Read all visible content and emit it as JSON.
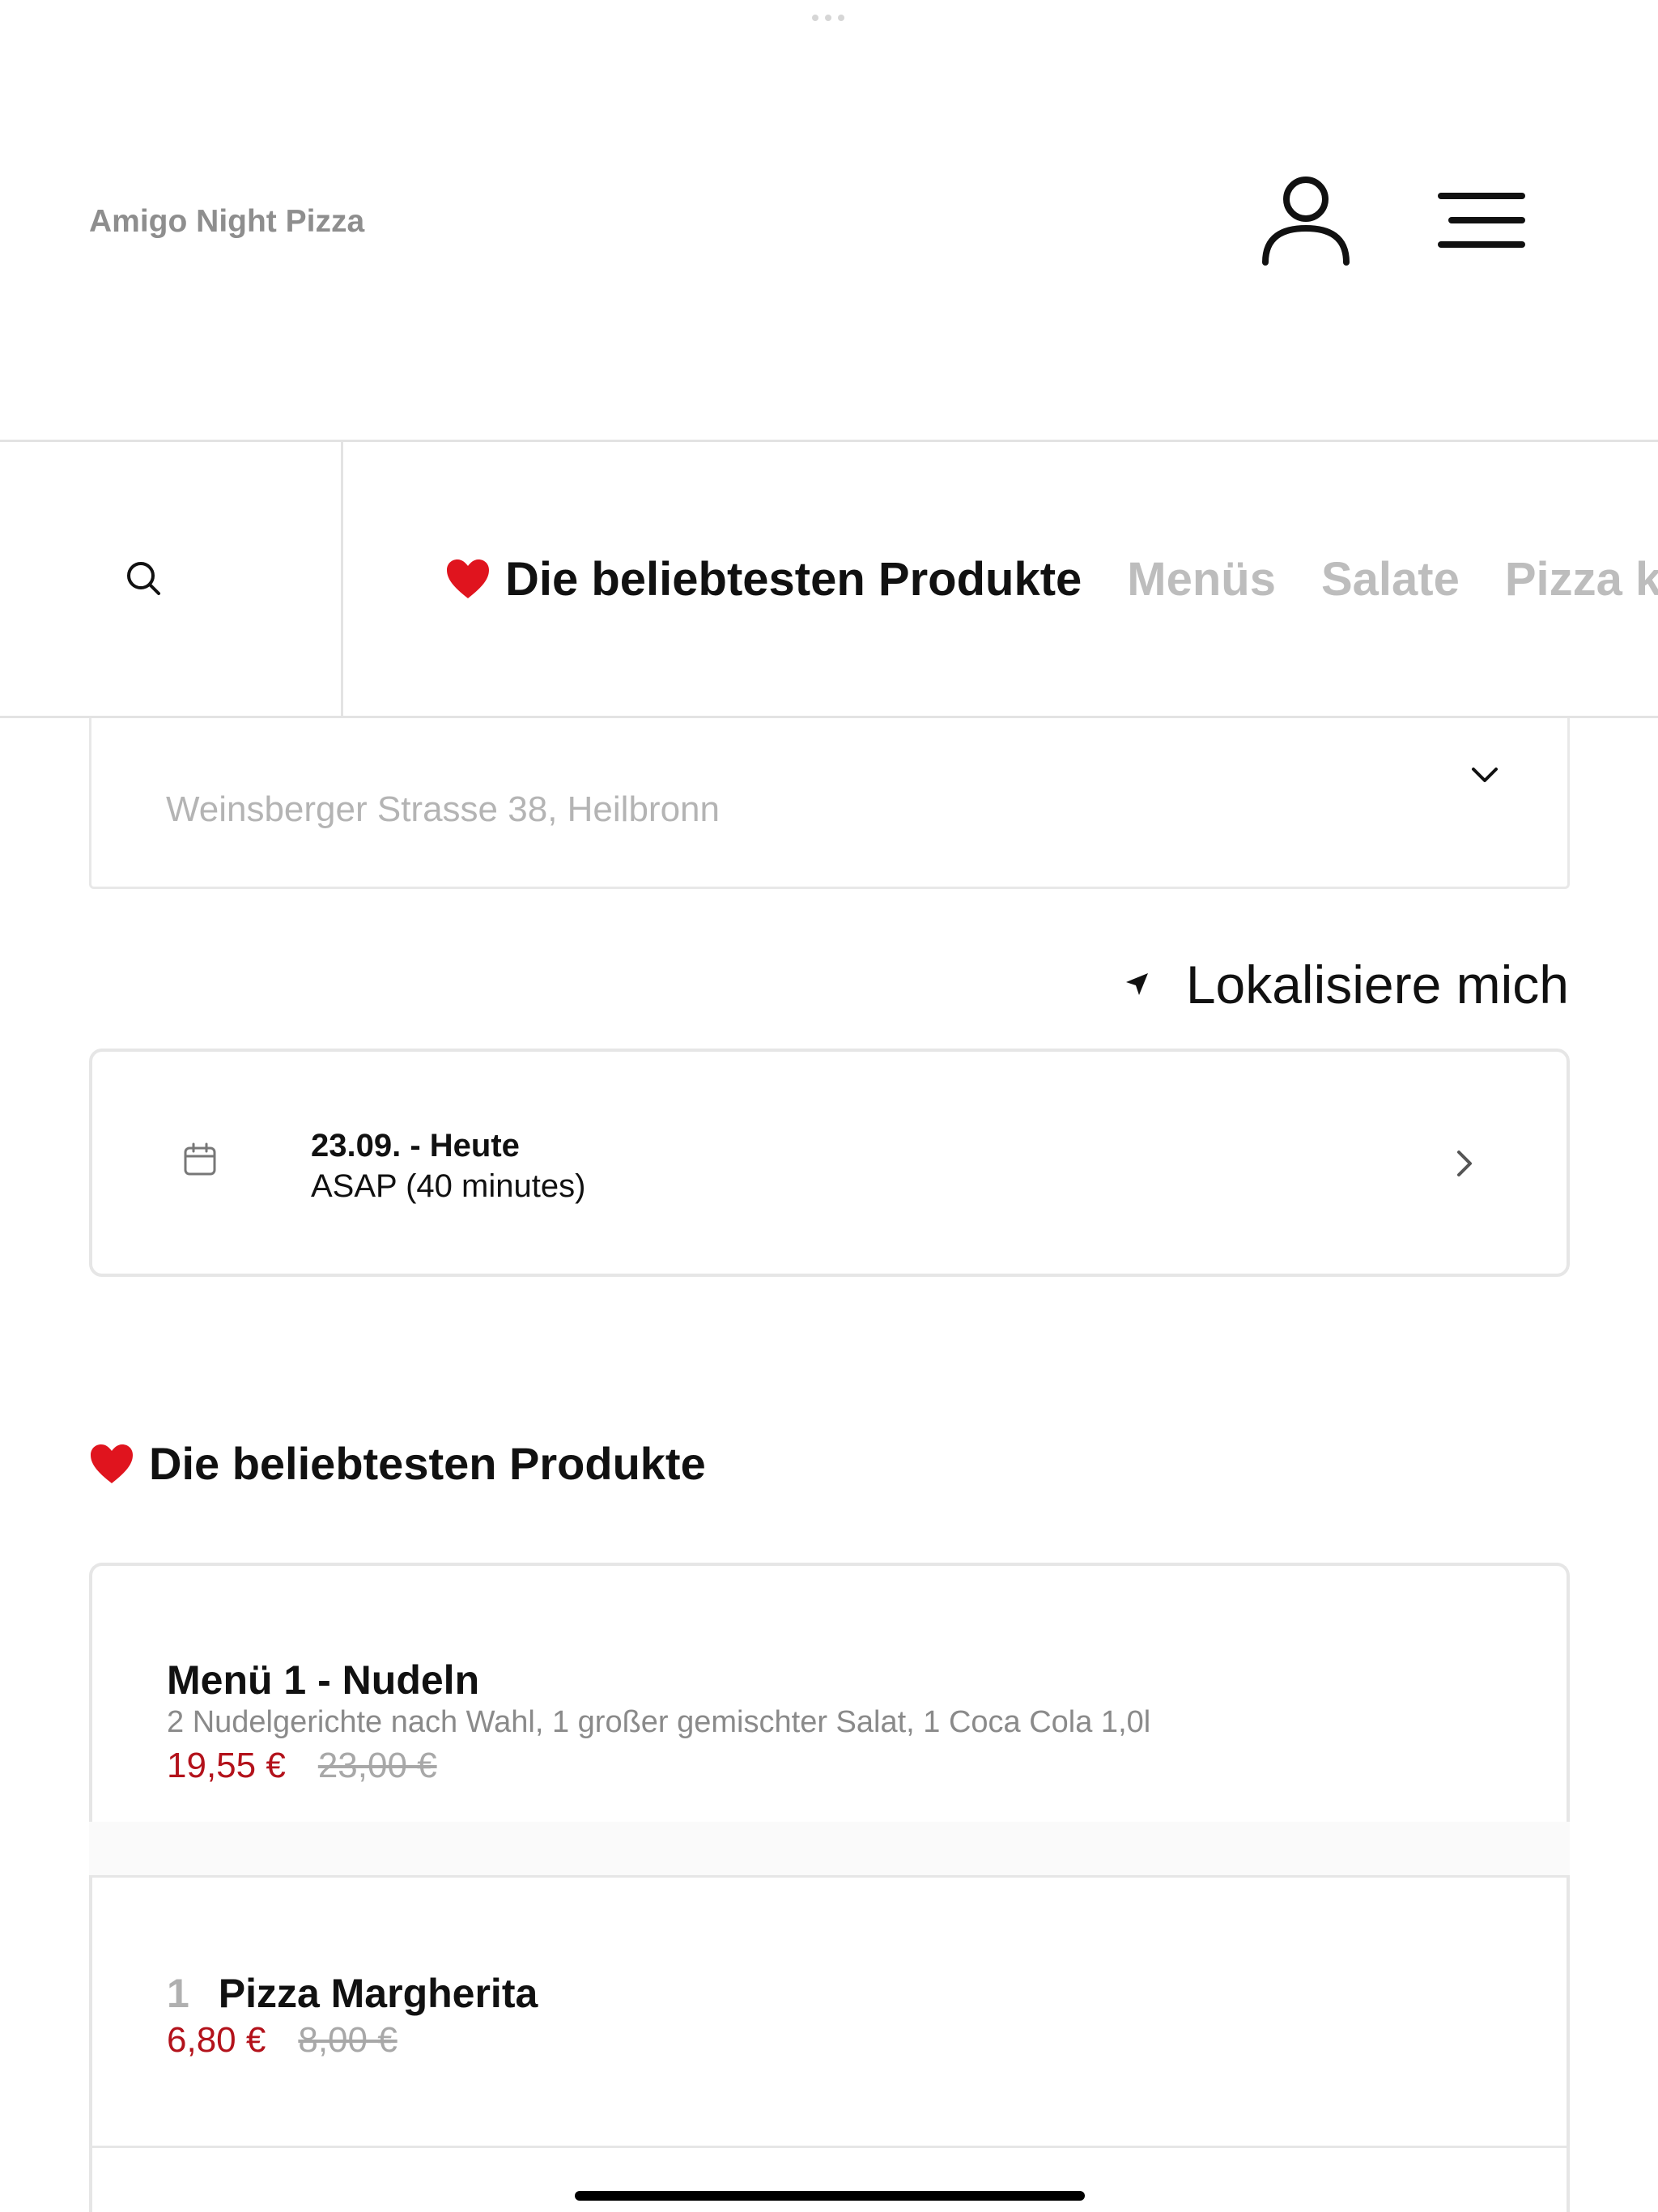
{
  "header": {
    "brand": "Amigo Night Pizza"
  },
  "categories": [
    {
      "label": "Die beliebtesten Produkte",
      "active": true
    },
    {
      "label": "Menüs",
      "active": false
    },
    {
      "label": "Salate",
      "active": false
    },
    {
      "label": "Pizza k",
      "active": false
    }
  ],
  "address": {
    "placeholder": "Weinsberger Strasse 38, Heilbronn"
  },
  "locate": {
    "label": "Lokalisiere mich"
  },
  "delivery_time": {
    "date": "23.09. - Heute",
    "time": "ASAP (40 minutes)"
  },
  "section": {
    "title": "Die beliebtesten Produkte"
  },
  "products": [
    {
      "name": "Menü 1 - Nudeln",
      "description": "2 Nudelgerichte nach Wahl, 1 großer gemischter Salat, 1 Coca Cola 1,0l",
      "price": "19,55 €",
      "old_price": "23,00 €"
    },
    {
      "qty": "1",
      "name": "Pizza Margherita",
      "price": "6,80 €",
      "old_price": "8,00 €"
    }
  ],
  "colors": {
    "accent": "#b3121b",
    "heart": "#e0141e",
    "muted": "#bdbdbd"
  }
}
